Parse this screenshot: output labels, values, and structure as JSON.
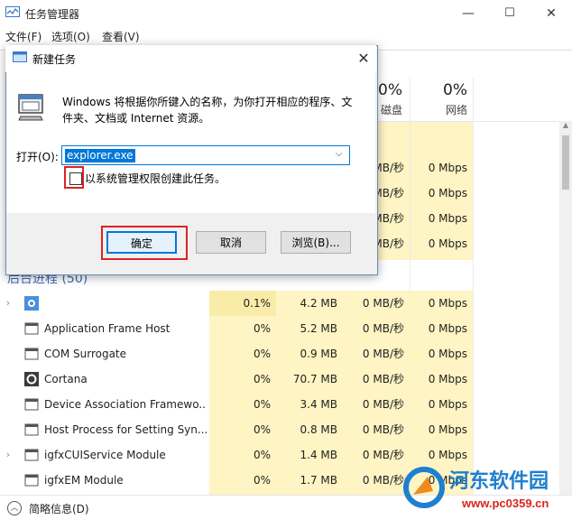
{
  "window": {
    "title": "任务管理器",
    "controls": {
      "minimize": "—",
      "maximize": "☐",
      "close": "✕"
    }
  },
  "menu": [
    "文件(F)",
    "选项(O)",
    "查看(V)"
  ],
  "columns": [
    {
      "percent": "0%",
      "name": "磁盘"
    },
    {
      "percent": "0%",
      "name": "网络"
    }
  ],
  "upper_rows": [
    {
      "disk": "MB/秒",
      "net": "0 Mbps"
    },
    {
      "disk": "MB/秒",
      "net": "0 Mbps"
    },
    {
      "disk": "MB/秒",
      "net": "0 Mbps"
    },
    {
      "disk": "MB/秒",
      "net": "0 Mbps"
    }
  ],
  "background_section": "后台进程 (50)",
  "rows": [
    {
      "name": "",
      "cpu": "0.1%",
      "mem": "4.2 MB",
      "disk": "0 MB/秒",
      "net": "0 Mbps",
      "expand": true,
      "icon": "gear-icon"
    },
    {
      "name": "Application Frame Host",
      "cpu": "0%",
      "mem": "5.2 MB",
      "disk": "0 MB/秒",
      "net": "0 Mbps",
      "expand": false,
      "icon": "app-icon"
    },
    {
      "name": "COM Surrogate",
      "cpu": "0%",
      "mem": "0.9 MB",
      "disk": "0 MB/秒",
      "net": "0 Mbps",
      "expand": false,
      "icon": "app-icon"
    },
    {
      "name": "Cortana",
      "cpu": "0%",
      "mem": "70.7 MB",
      "disk": "0 MB/秒",
      "net": "0 Mbps",
      "expand": false,
      "icon": "cortana-icon"
    },
    {
      "name": "Device Association Framewo...",
      "cpu": "0%",
      "mem": "3.4 MB",
      "disk": "0 MB/秒",
      "net": "0 Mbps",
      "expand": false,
      "icon": "app-icon"
    },
    {
      "name": "Host Process for Setting Syn...",
      "cpu": "0%",
      "mem": "0.8 MB",
      "disk": "0 MB/秒",
      "net": "0 Mbps",
      "expand": false,
      "icon": "app-icon"
    },
    {
      "name": "igfxCUIService Module",
      "cpu": "0%",
      "mem": "1.4 MB",
      "disk": "0 MB/秒",
      "net": "0 Mbps",
      "expand": true,
      "icon": "app-icon"
    },
    {
      "name": "igfxEM Module",
      "cpu": "0%",
      "mem": "1.7 MB",
      "disk": "0 MB/秒",
      "net": "0 Mbps",
      "expand": false,
      "icon": "app-icon"
    }
  ],
  "footer": {
    "label": "简略信息(D)"
  },
  "watermark": {
    "text": "河东软件园",
    "url": "www.pc0359.cn"
  },
  "dialog": {
    "title": "新建任务",
    "description": "Windows 将根据你所键入的名称，为你打开相应的程序、文件夹、文档或 Internet 资源。",
    "open_label": "打开(O):",
    "input_value": "explorer.exe",
    "checkbox_label": "以系统管理权限创建此任务。",
    "checkbox_checked": false,
    "buttons": {
      "ok": "确定",
      "cancel": "取消",
      "browse": "浏览(B)..."
    }
  }
}
